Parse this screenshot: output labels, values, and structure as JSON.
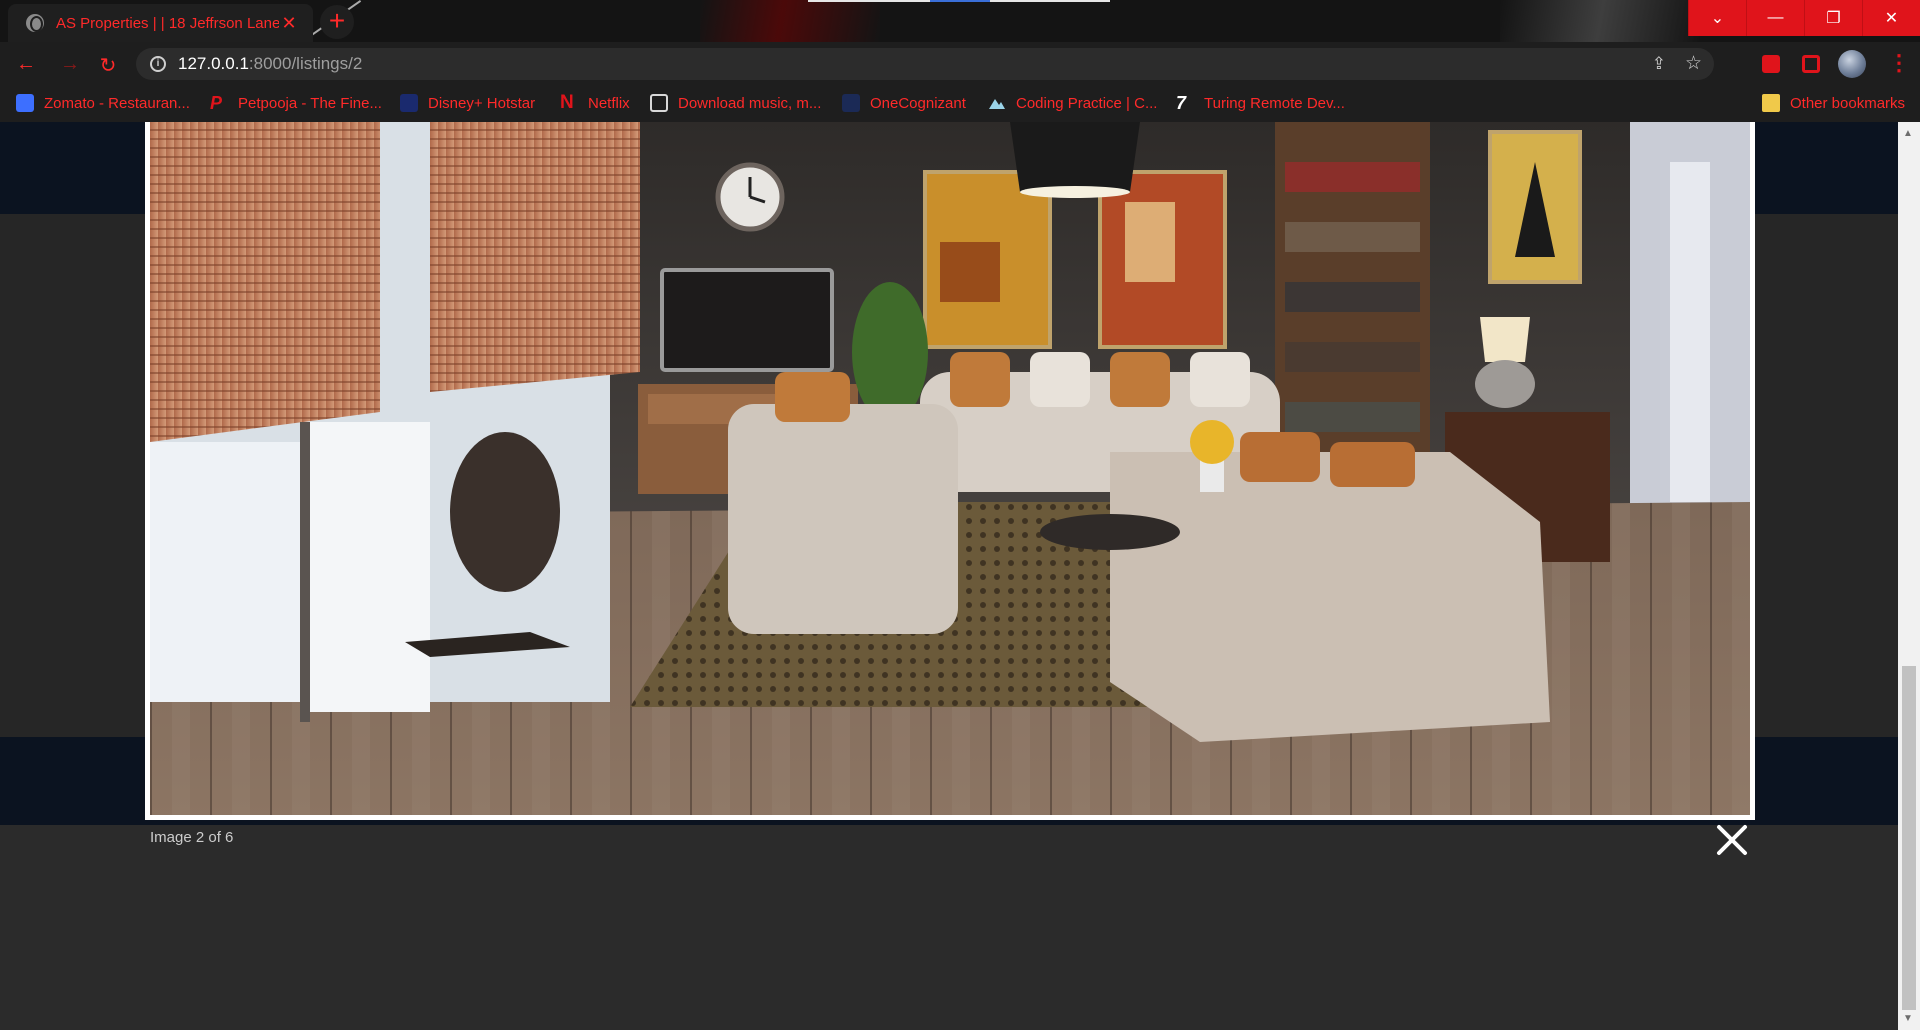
{
  "browser": {
    "tab_title": "AS Properties | | 18 Jeffrson Lane",
    "tab_close": "✕",
    "new_tab": "+",
    "window_buttons": [
      "⌄",
      "—",
      "❐",
      "✕"
    ],
    "url_host": "127.0.0.1",
    "url_rest": ":8000/listings/2",
    "bookmarks": [
      {
        "label": "Zomato - Restauran...",
        "icon_color": "#3d6fff"
      },
      {
        "label": "Petpooja - The Fine...",
        "icon_color": "#e0141b"
      },
      {
        "label": "Disney+ Hotstar",
        "icon_color": "#1a2a6e"
      },
      {
        "label": "Netflix",
        "icon_color": "#e0141b"
      },
      {
        "label": "Download music, m...",
        "icon_color": "#d8d8d8"
      },
      {
        "label": "OneCognizant",
        "icon_color": "#1b2a56"
      },
      {
        "label": "Coding Practice | C...",
        "icon_color": "#9ad3e8"
      },
      {
        "label": "Turing Remote Dev...",
        "icon_color": "#ffffff"
      }
    ],
    "other_bookmarks": "Other bookmarks",
    "accent_color": "#ff2a2a"
  },
  "lightbox": {
    "caption": "Image 2 of 6",
    "close_icon": "close-icon"
  }
}
